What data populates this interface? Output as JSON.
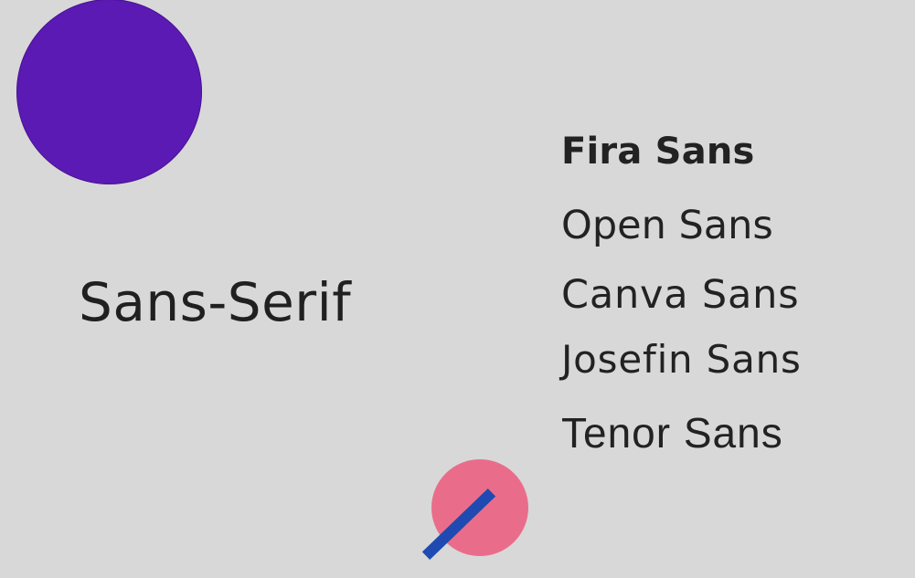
{
  "slide": {
    "title": "Sans-Serif",
    "fonts": [
      "Fira Sans",
      "Open Sans",
      "Canva Sans",
      "Josefin Sans",
      "Tenor Sans"
    ],
    "colors": {
      "background": "#d8d8d8",
      "text": "#222222",
      "purple_circle": "#5b1ab3",
      "pink_circle": "#e96d8a",
      "blue_bar": "#1f4ab1"
    },
    "decorations": [
      "purple-circle",
      "pink-circle",
      "blue-bar"
    ]
  }
}
